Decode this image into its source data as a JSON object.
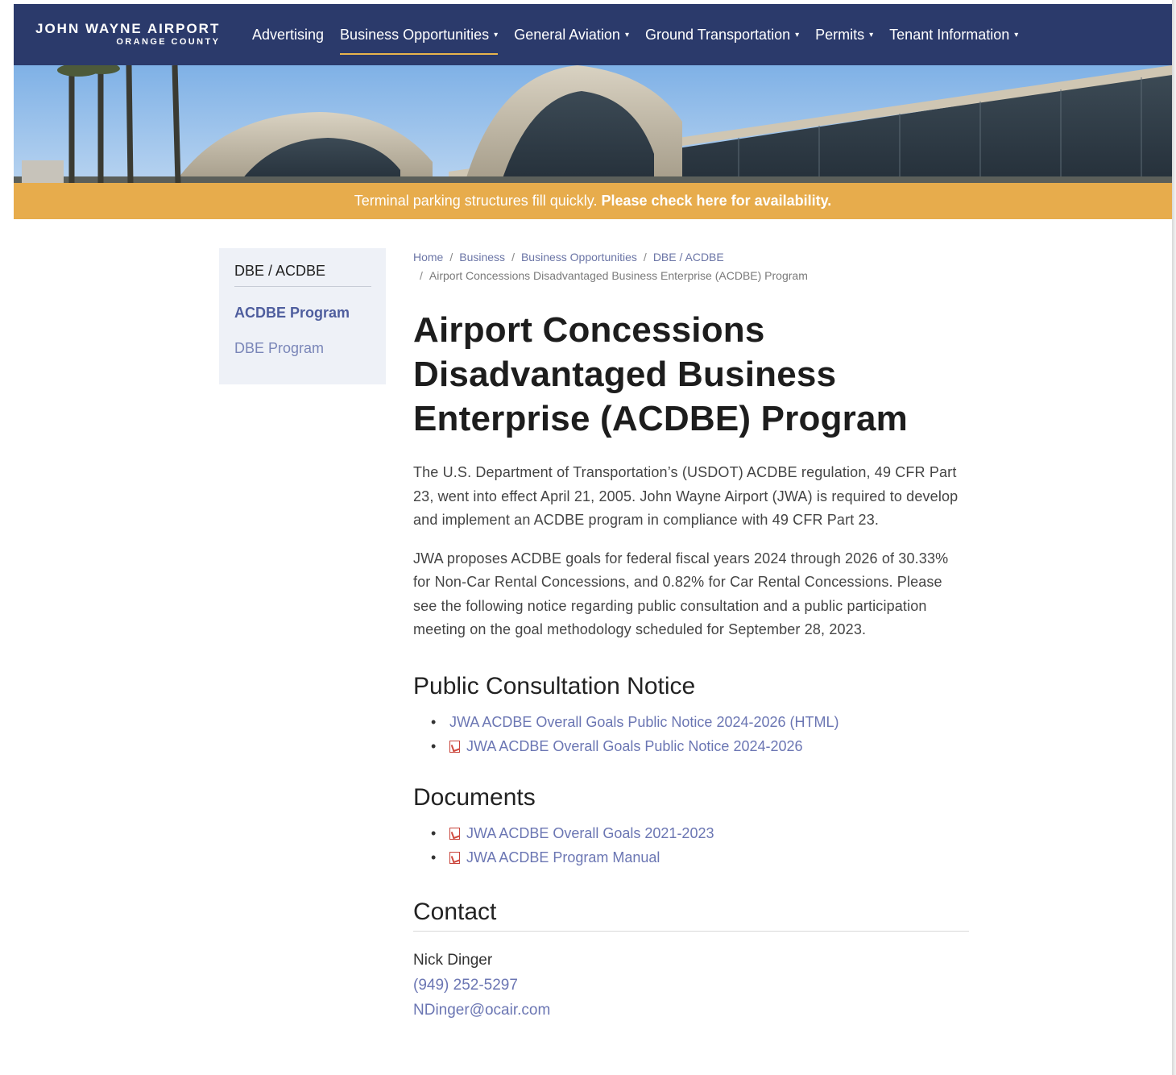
{
  "header": {
    "logo_line1": "JOHN WAYNE AIRPORT",
    "logo_line2": "ORANGE COUNTY",
    "nav": [
      {
        "label": "Advertising",
        "dropdown": false
      },
      {
        "label": "Business Opportunities",
        "dropdown": true
      },
      {
        "label": "General Aviation",
        "dropdown": true
      },
      {
        "label": "Ground Transportation",
        "dropdown": true
      },
      {
        "label": "Permits",
        "dropdown": true
      },
      {
        "label": "Tenant Information",
        "dropdown": true
      }
    ],
    "caret": "▾"
  },
  "alert": {
    "text": "Terminal parking structures fill quickly.",
    "link": "Please check here for availability."
  },
  "sidebar": {
    "title": "DBE / ACDBE",
    "items": [
      "ACDBE Program",
      "DBE Program"
    ]
  },
  "breadcrumb": {
    "items": [
      "Home",
      "Business",
      "Business Opportunities",
      "DBE / ACDBE"
    ],
    "current": "Airport Concessions Disadvantaged Business Enterprise (ACDBE) Program",
    "separator": "/"
  },
  "main": {
    "title": "Airport Concessions Disadvantaged Business Enterprise (ACDBE) Program",
    "paragraphs": [
      "The U.S. Department of Transportation’s (USDOT) ACDBE regulation, 49 CFR Part 23, went into effect April 21, 2005. John Wayne Airport (JWA) is required to develop and implement an ACDBE program in compliance with 49 CFR Part 23.",
      "JWA proposes ACDBE goals for federal fiscal years 2024 through 2026 of 30.33% for Non-Car Rental Concessions, and 0.82% for Car Rental Concessions. Please see the following notice regarding public consultation and a public participation meeting on the goal methodology scheduled for September 28, 2023."
    ],
    "notice_heading": "Public Consultation Notice",
    "notice_links": [
      {
        "label": "JWA ACDBE Overall Goals Public Notice 2024-2026 (HTML)",
        "icon": ""
      },
      {
        "label": "JWA ACDBE Overall Goals Public Notice 2024-2026",
        "icon": "pdf-icon"
      }
    ],
    "docs_heading": "Documents",
    "doc_links": [
      {
        "label": "JWA ACDBE Overall Goals 2021-2023",
        "icon": "pdf-icon"
      },
      {
        "label": "JWA ACDBE Program Manual",
        "icon": "pdf-icon"
      }
    ],
    "contact_heading": "Contact",
    "contact": {
      "name": "Nick Dinger",
      "phone": "(949) 252-5297",
      "email": "NDinger@ocair.com"
    }
  },
  "colors": {
    "navbar": "#2b3a6b",
    "alert": "#e7ac4c",
    "link": "#6b76b3",
    "sidebar_bg": "#eef1f7"
  }
}
